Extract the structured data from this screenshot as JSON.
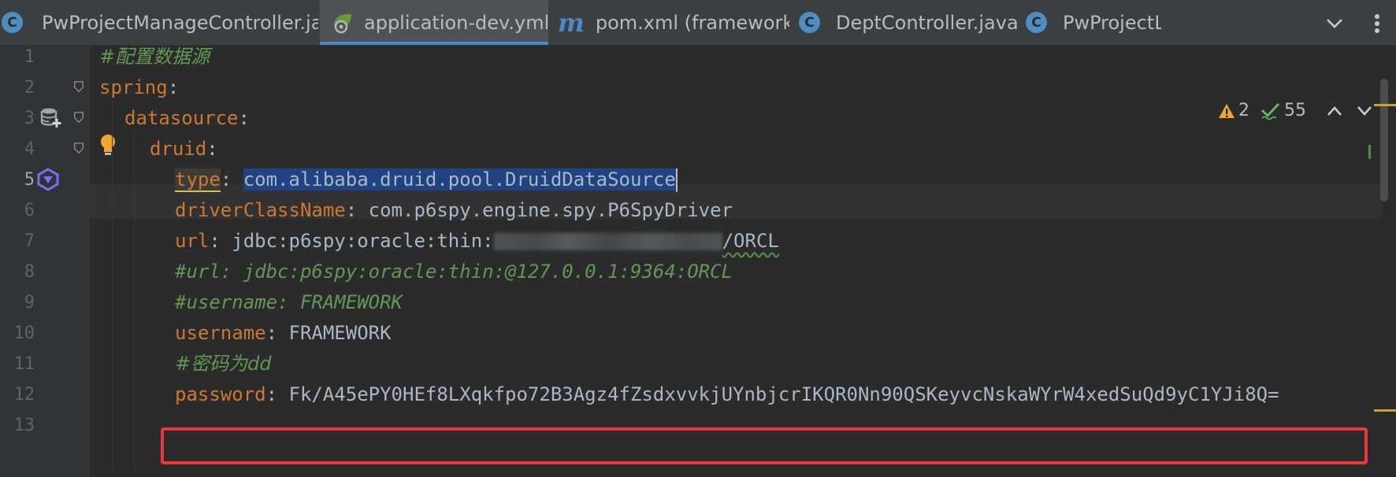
{
  "tabs": [
    {
      "label": "PwProjectManageController.java",
      "icon": "java-class-icon",
      "close": "×"
    },
    {
      "label": "application-dev.yml",
      "icon": "spring-yaml-icon",
      "close": "×"
    },
    {
      "label": "pom.xml (framework)",
      "icon": "maven-icon",
      "close": "×"
    },
    {
      "label": "DeptController.java",
      "icon": "java-class-icon",
      "close": "×"
    },
    {
      "label": "PwProjectLed",
      "icon": "java-class-icon"
    }
  ],
  "tab_icon_letter": "C",
  "maven_letter": "m",
  "inspections": {
    "warnings": "2",
    "ok": "55"
  },
  "lines": {
    "n": [
      "1",
      "2",
      "3",
      "4",
      "5",
      "6",
      "7",
      "8",
      "9",
      "10",
      "11",
      "12",
      "13"
    ],
    "l1": "#配置数据源",
    "l2_key": "spring",
    "l3_key": "datasource",
    "l4_key": "druid",
    "l5_key": "type",
    "l5_val": "com.alibaba.druid.pool.DruidDataSource",
    "l6_key": "driverClassName",
    "l6_val": "com.p6spy.engine.spy.P6SpyDriver",
    "l7_key": "url",
    "l7_val_a": "jdbc:p6spy:oracle:thin:",
    "l7_val_b": "/ORCL",
    "l8": "#url: jdbc:p6spy:oracle:thin:@127.0.0.1:9364:ORCL",
    "l9": "#username: FRAMEWORK",
    "l10_key": "username",
    "l10_val": "FRAMEWORK",
    "l11": "#密码为dd",
    "l12_key": "password",
    "l12_val": "Fk/A45ePY0HEf8LXqkfpo72B3Agz4fZsdxvvkjUYnbjcrIKQR0Nn90QSKeyvcNskaWYrW4xedSuQd9yC1YJi8Q="
  },
  "colors": {
    "accent": "#4a88c7",
    "highlight_box": "#e8383d",
    "key": "#cc7832",
    "comment": "#629755"
  }
}
